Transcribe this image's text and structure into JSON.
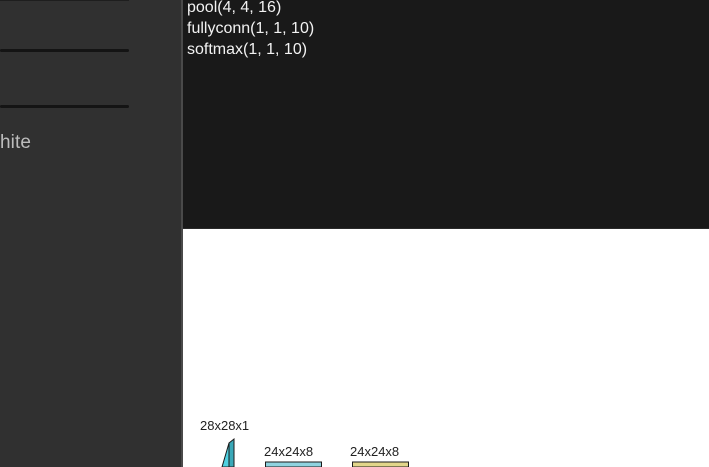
{
  "sidebar": {
    "description_fragment": "t and white"
  },
  "console": {
    "lines": [
      "pool(4, 4, 16)",
      "fullyconn(1, 1, 10)",
      "softmax(1, 1, 10)"
    ]
  },
  "network_diagram": {
    "layers": [
      {
        "label": "28x28x1",
        "color": "#4fd0e0"
      },
      {
        "label": "24x24x8",
        "color": "#8fd3df"
      },
      {
        "label": "24x24x8",
        "color": "#e2d68a"
      }
    ]
  }
}
